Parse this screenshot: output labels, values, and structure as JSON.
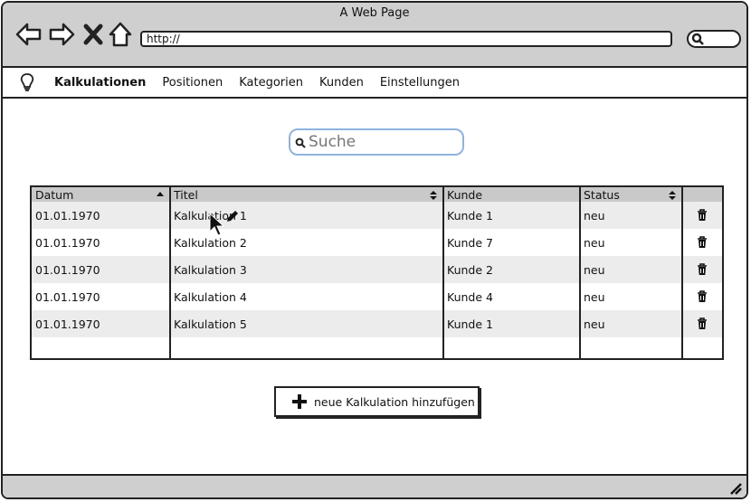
{
  "browser": {
    "title": "A Web Page",
    "url": "http://"
  },
  "menu": {
    "items": [
      "Kalkulationen",
      "Positionen",
      "Kategorien",
      "Kunden",
      "Einstellungen"
    ],
    "active": "Kalkulationen"
  },
  "search": {
    "placeholder": "Suche"
  },
  "table": {
    "columns": [
      "Datum",
      "Titel",
      "Kunde",
      "Status",
      ""
    ],
    "rows": [
      [
        "01.01.1970",
        "Kalkulation 1",
        "Kunde 1",
        "neu"
      ],
      [
        "01.01.1970",
        "Kalkulation 2",
        "Kunde 7",
        "neu"
      ],
      [
        "01.01.1970",
        "Kalkulation 3",
        "Kunde 2",
        "neu"
      ],
      [
        "01.01.1970",
        "Kalkulation 4",
        "Kunde 4",
        "neu"
      ],
      [
        "01.01.1970",
        "Kalkulation 5",
        "Kunde 1",
        "neu"
      ]
    ]
  },
  "add_button": {
    "label": "neue Kalkulation hinzufügen"
  },
  "icons": {
    "back": "back-arrow-icon",
    "forward": "forward-arrow-icon",
    "stop": "close-icon",
    "home": "home-icon",
    "search": "search-icon",
    "logo": "lightbulb-icon",
    "sort_asc": "sort-ascending-icon",
    "sort_both": "sort-icon",
    "delete": "trash-icon",
    "add": "plus-icon",
    "edit": "pencil-icon",
    "cursor": "mouse-pointer-icon",
    "resize": "resize-grip-icon"
  }
}
